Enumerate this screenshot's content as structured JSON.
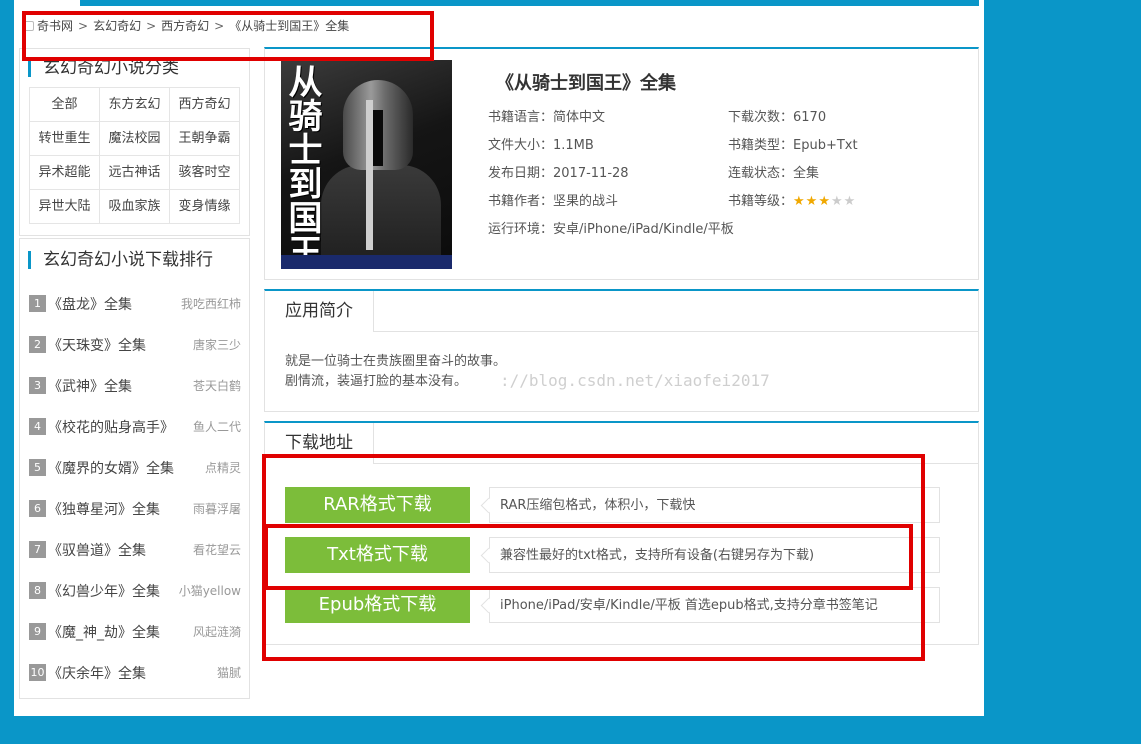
{
  "breadcrumb": [
    "奇书网",
    "玄幻奇幻",
    "西方奇幻",
    "《从骑士到国王》全集"
  ],
  "sidebar": {
    "category_title": "玄幻奇幻小说分类",
    "categories": [
      "全部",
      "东方玄幻",
      "西方奇幻",
      "转世重生",
      "魔法校园",
      "王朝争霸",
      "异术超能",
      "远古神话",
      "骇客时空",
      "异世大陆",
      "吸血家族",
      "变身情缘"
    ],
    "ranking_title": "玄幻奇幻小说下载排行",
    "ranking": [
      {
        "num": "1",
        "title": "《盘龙》全集",
        "author": "我吃西红柿"
      },
      {
        "num": "2",
        "title": "《天珠变》全集",
        "author": "唐家三少"
      },
      {
        "num": "3",
        "title": "《武神》全集",
        "author": "苍天白鹤"
      },
      {
        "num": "4",
        "title": "《校花的贴身高手》",
        "author": "鱼人二代"
      },
      {
        "num": "5",
        "title": "《魔界的女婿》全集",
        "author": "点精灵"
      },
      {
        "num": "6",
        "title": "《独尊星河》全集",
        "author": "雨暮浮屠"
      },
      {
        "num": "7",
        "title": "《驭兽道》全集",
        "author": "看花望云"
      },
      {
        "num": "8",
        "title": "《幻兽少年》全集",
        "author": "小猫yellow"
      },
      {
        "num": "9",
        "title": "《魔_神_劫》全集",
        "author": "风起涟漪"
      },
      {
        "num": "10",
        "title": "《庆余年》全集",
        "author": "猫腻"
      }
    ]
  },
  "book": {
    "cover_title": "从骑士到国王",
    "title": "《从骑士到国王》全集",
    "language": "书籍语言：简体中文",
    "downloads": "下载次数：6170",
    "size": "文件大小：1.1MB",
    "type": "书籍类型：Epub+Txt",
    "date": "发布日期：2017-11-28",
    "status": "连载状态：全集",
    "author": "书籍作者：坚果的战斗",
    "rating_label": "书籍等级：",
    "rating": 3,
    "rating_max": 5,
    "platforms": "运行环境：安卓/iPhone/iPad/Kindle/平板"
  },
  "intro": {
    "tab": "应用简介",
    "line1": "就是一位骑士在贵族圈里奋斗的故事。",
    "line2": "剧情流，装逼打脸的基本没有。",
    "watermark": "://blog.csdn.net/xiaofei2017"
  },
  "download": {
    "tab": "下载地址",
    "items": [
      {
        "label": "RAR格式下载",
        "desc": "RAR压缩包格式，体积小，下载快"
      },
      {
        "label": "Txt格式下载",
        "desc": "兼容性最好的txt格式，支持所有设备(右键另存为下载)"
      },
      {
        "label": "Epub格式下载",
        "desc": "iPhone/iPad/安卓/Kindle/平板 首选epub格式,支持分章书签笔记"
      }
    ]
  },
  "colors": {
    "accent": "#0a96c8",
    "download_button": "#7cbd3a",
    "annotation": "#e00000",
    "star": "#f0a800"
  }
}
